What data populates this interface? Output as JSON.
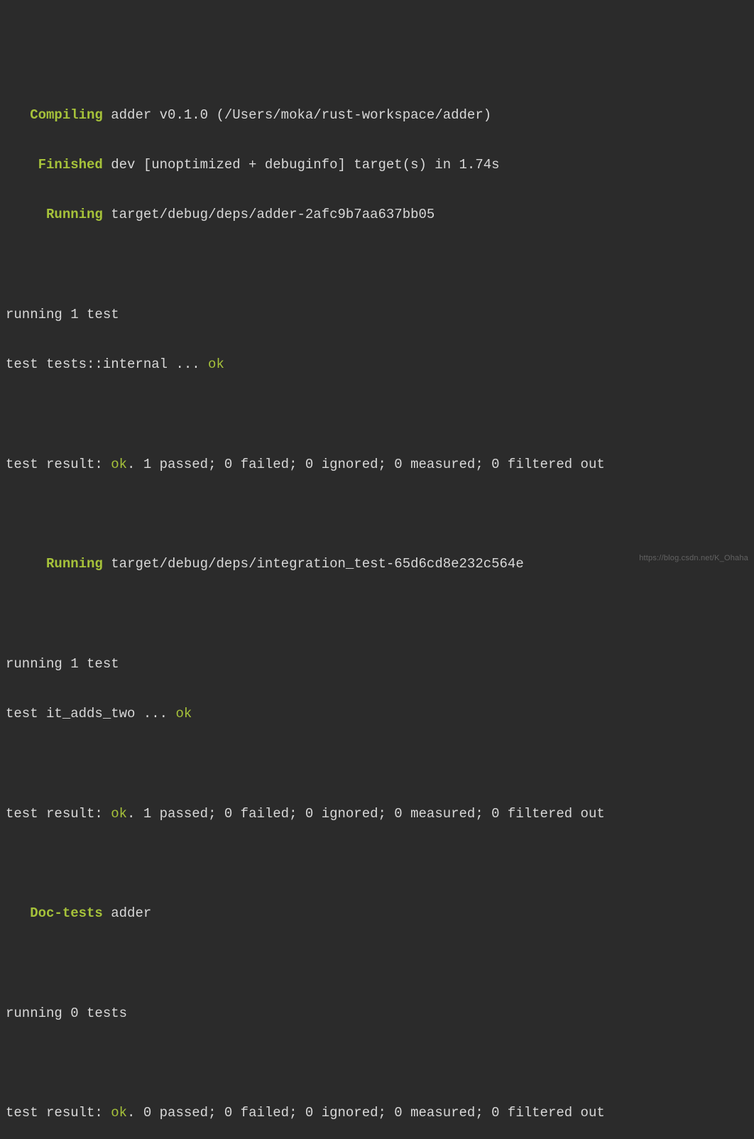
{
  "lines": {
    "compiling": {
      "label": "Compiling",
      "rest": " adder v0.1.0 (/Users/moka/rust-workspace/adder)",
      "indent": "   "
    },
    "finished": {
      "label": "Finished",
      "rest": " dev [unoptimized + debuginfo] target(s) in 1.74s",
      "indent": "    "
    },
    "running1": {
      "label": "Running",
      "rest": " target/debug/deps/adder-2afc9b7aa637bb05",
      "indent": "     "
    },
    "section1_running": "running 1 test",
    "section1_test_line": {
      "prefix": "test tests::internal ... ",
      "status": "ok"
    },
    "section1_result": {
      "prefix": "test result: ",
      "status": "ok",
      "rest": ". 1 passed; 0 failed; 0 ignored; 0 measured; 0 filtered out"
    },
    "running2": {
      "label": "Running",
      "rest": " target/debug/deps/integration_test-65d6cd8e232c564e",
      "indent": "     "
    },
    "section2_running": "running 1 test",
    "section2_test_line": {
      "prefix": "test it_adds_two ... ",
      "status": "ok"
    },
    "section2_result": {
      "prefix": "test result: ",
      "status": "ok",
      "rest": ". 1 passed; 0 failed; 0 ignored; 0 measured; 0 filtered out"
    },
    "doctests": {
      "label": "Doc-tests",
      "rest": " adder",
      "indent": "   "
    },
    "section3_running": "running 0 tests",
    "section3_result": {
      "prefix": "test result: ",
      "status": "ok",
      "rest": ". 0 passed; 0 failed; 0 ignored; 0 measured; 0 filtered out"
    }
  },
  "watermark": "https://blog.csdn.net/K_Ohaha"
}
